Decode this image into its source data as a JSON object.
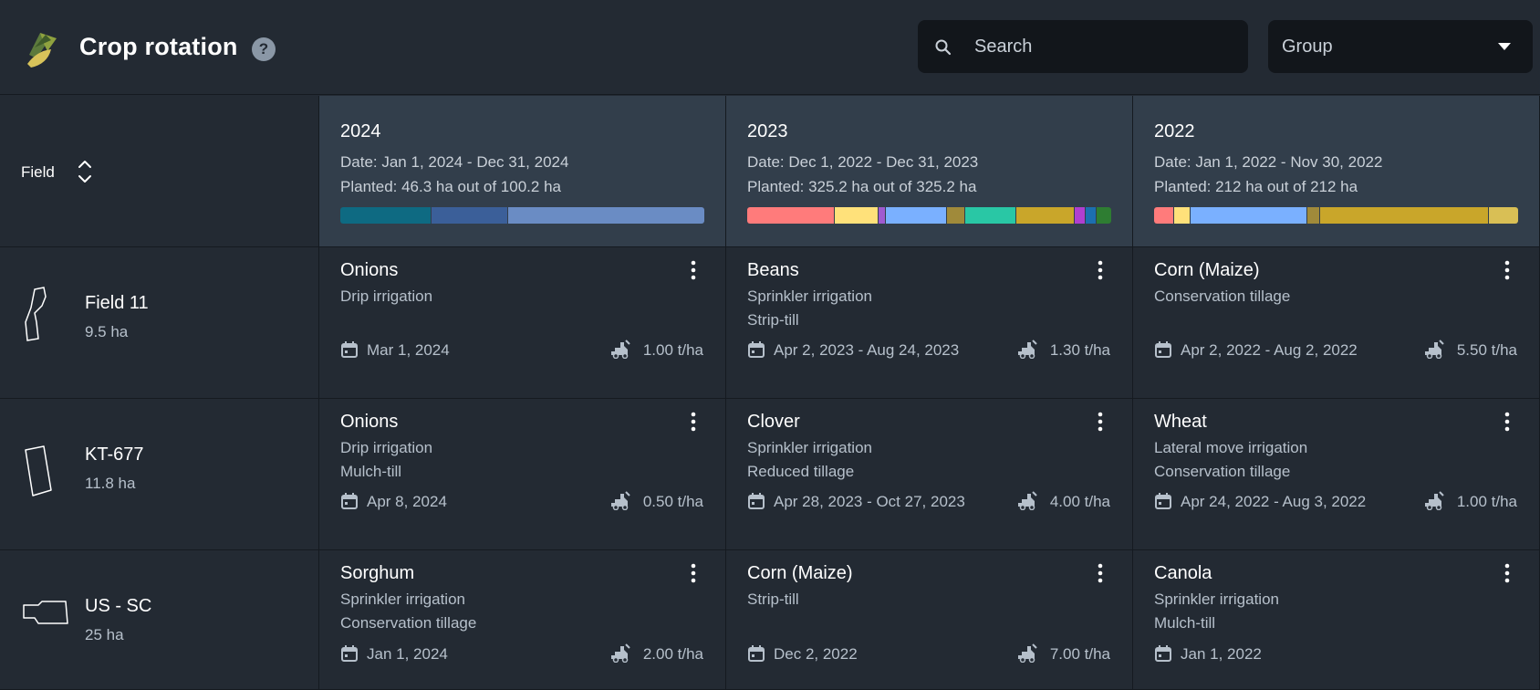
{
  "app": {
    "title": "Crop rotation",
    "help_symbol": "?"
  },
  "search": {
    "placeholder": "Search",
    "value": ""
  },
  "group": {
    "label": "Group"
  },
  "table": {
    "field_header": "Field",
    "years": [
      {
        "title": "2024",
        "date": "Date: Jan 1, 2024 - Dec 31, 2024",
        "planted": "Planted: 46.3 ha out of 100.2 ha",
        "segments": [
          {
            "color": "#0e6a82",
            "fraction": 0.25
          },
          {
            "color": "#3b5f99",
            "fraction": 0.21
          },
          {
            "color": "#6a8cc4",
            "fraction": 0.54
          }
        ]
      },
      {
        "title": "2023",
        "date": "Date: Dec 1, 2022 - Dec 31, 2023",
        "planted": "Planted: 325.2 ha out of 325.2 ha",
        "segments": [
          {
            "color": "#ff7b7b",
            "fraction": 0.24
          },
          {
            "color": "#ffe17a",
            "fraction": 0.12
          },
          {
            "color": "#a05ad0",
            "fraction": 0.02
          },
          {
            "color": "#7ab0ff",
            "fraction": 0.17
          },
          {
            "color": "#a08a3a",
            "fraction": 0.05
          },
          {
            "color": "#29c7a5",
            "fraction": 0.14
          },
          {
            "color": "#c9a62a",
            "fraction": 0.16
          },
          {
            "color": "#b03fd0",
            "fraction": 0.03
          },
          {
            "color": "#1c6fb0",
            "fraction": 0.03
          },
          {
            "color": "#2e7d32",
            "fraction": 0.04
          }
        ]
      },
      {
        "title": "2022",
        "date": "Date: Jan 1, 2022 - Nov 30, 2022",
        "planted": "Planted: 212 ha out of 212 ha",
        "segments": [
          {
            "color": "#ff7b7b",
            "fraction": 0.055
          },
          {
            "color": "#ffe17a",
            "fraction": 0.045
          },
          {
            "color": "#7ab0ff",
            "fraction": 0.32
          },
          {
            "color": "#a08a3a",
            "fraction": 0.035
          },
          {
            "color": "#c9a62a",
            "fraction": 0.465
          },
          {
            "color": "#d9bf55",
            "fraction": 0.08
          }
        ]
      }
    ],
    "fields": [
      {
        "name": "Field 11",
        "area": "9.5 ha",
        "crops": [
          {
            "name": "Onions",
            "line1": "Drip irrigation",
            "line2": "",
            "date": "Mar 1, 2024",
            "yield": "1.00 t/ha"
          },
          {
            "name": "Beans",
            "line1": "Sprinkler irrigation",
            "line2": "Strip-till",
            "date": "Apr 2, 2023 - Aug 24, 2023",
            "yield": "1.30 t/ha"
          },
          {
            "name": "Corn (Maize)",
            "line1": "Conservation tillage",
            "line2": "",
            "date": "Apr 2, 2022 - Aug 2, 2022",
            "yield": "5.50 t/ha"
          }
        ]
      },
      {
        "name": "KT-677",
        "area": "11.8 ha",
        "crops": [
          {
            "name": "Onions",
            "line1": "Drip irrigation",
            "line2": "Mulch-till",
            "date": "Apr 8, 2024",
            "yield": "0.50 t/ha"
          },
          {
            "name": "Clover",
            "line1": "Sprinkler irrigation",
            "line2": "Reduced tillage",
            "date": "Apr 28, 2023 - Oct 27, 2023",
            "yield": "4.00 t/ha"
          },
          {
            "name": "Wheat",
            "line1": "Lateral move irrigation",
            "line2": "Conservation tillage",
            "date": "Apr 24, 2022 - Aug 3, 2022",
            "yield": "1.00 t/ha"
          }
        ]
      },
      {
        "name": "US - SC",
        "area": "25 ha",
        "crops": [
          {
            "name": "Sorghum",
            "line1": "Sprinkler irrigation",
            "line2": "Conservation tillage",
            "date": "Jan 1, 2024",
            "yield": "2.00 t/ha"
          },
          {
            "name": "Corn (Maize)",
            "line1": "Strip-till",
            "line2": "",
            "date": "Dec 2, 2022",
            "yield": "7.00 t/ha"
          },
          {
            "name": "Canola",
            "line1": "Sprinkler irrigation",
            "line2": "Mulch-till",
            "date": "Jan 1, 2022",
            "yield": ""
          }
        ]
      }
    ]
  },
  "colors": {
    "background": "#232a33",
    "header_cell": "#323e4b",
    "input_bg": "#12161b",
    "muted_text": "#b6c0cb"
  },
  "icons": {
    "logo": "crop-leaf-logo",
    "help": "question-icon",
    "search": "search-icon",
    "dropdown": "caret-down-icon",
    "sort": "sort-icon",
    "more": "more-vertical-icon",
    "calendar": "calendar-icon",
    "yield": "harvester-icon"
  }
}
